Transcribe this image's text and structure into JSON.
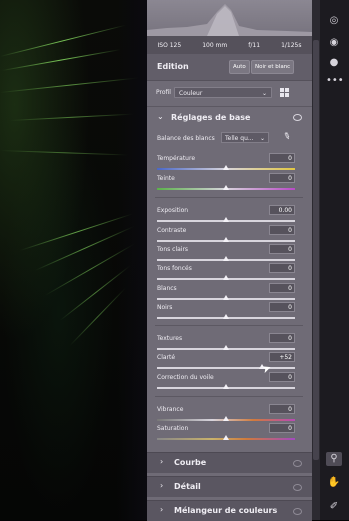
{
  "meta": {
    "iso": "ISO 125",
    "focal": "100 mm",
    "aperture": "f/11",
    "shutter": "1/125s"
  },
  "edition": {
    "title": "Edition",
    "auto_label": "Auto",
    "bw_label": "Noir et blanc"
  },
  "profil": {
    "label": "Profil",
    "value": "Couleur"
  },
  "reglages": {
    "title": "Réglages de base"
  },
  "white_balance": {
    "label": "Balance des blancs",
    "value": "Telle qu..."
  },
  "sliders": [
    {
      "label": "Température",
      "value": "0",
      "level": 0.5
    },
    {
      "label": "Teinte",
      "value": "0",
      "level": 0.5
    },
    {
      "label": "Exposition",
      "value": "0.00",
      "level": 0.5
    },
    {
      "label": "Contraste",
      "value": "0",
      "level": 0.5
    },
    {
      "label": "Tons clairs",
      "value": "0",
      "level": 0.5
    },
    {
      "label": "Tons foncés",
      "value": "0",
      "level": 0.5
    },
    {
      "label": "Blancs",
      "value": "0",
      "level": 0.5
    },
    {
      "label": "Noirs",
      "value": "0",
      "level": 0.5
    },
    {
      "label": "Textures",
      "value": "0",
      "level": 0.5
    },
    {
      "label": "Clarté",
      "value": "+52",
      "level": 0.76
    },
    {
      "label": "Correction du voile",
      "value": "0",
      "level": 0.5
    },
    {
      "label": "Vibrance",
      "value": "0",
      "level": 0.5
    },
    {
      "label": "Saturation",
      "value": "0",
      "level": 0.5
    }
  ],
  "sections": [
    {
      "title": "Courbe"
    },
    {
      "title": "Détail"
    },
    {
      "title": "Mélangeur de couleurs"
    }
  ],
  "colors": {
    "panel": "#6f6b76",
    "accent_green": "#8ce064"
  },
  "toolbar_icons": [
    "search-icon",
    "eye-icon",
    "spot-removal-icon",
    "more-icon",
    "zoom-icon",
    "hand-icon",
    "brush-icon"
  ]
}
